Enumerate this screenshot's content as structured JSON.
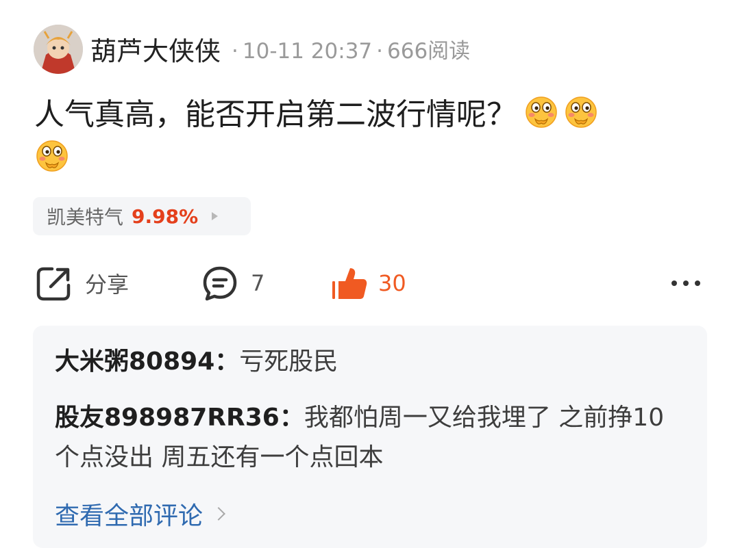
{
  "post": {
    "author": "葫芦大侠侠",
    "separator": "·",
    "timestamp": "10-11 20:37",
    "reads": "666阅读",
    "content": "人气真高，能否开启第二波行情呢？",
    "emoji_icon": "thinking-face-emoji",
    "emoji_count": 3
  },
  "stock": {
    "name": "凯美特气",
    "change": "9.98%",
    "change_color": "#e4401c"
  },
  "actions": {
    "share_label": "分享",
    "comment_count": "7",
    "like_count": "30",
    "like_color": "#f05a22"
  },
  "comments": [
    {
      "user": "大米粥80894",
      "colon": "：",
      "text": "亏死股民"
    },
    {
      "user": "股友898987RR36",
      "colon": "：",
      "text": "我都怕周一又给我埋了 之前挣10个点没出 周五还有一个点回本"
    }
  ],
  "view_all_label": "查看全部评论",
  "colors": {
    "link": "#2f6ab0",
    "comment_bg": "#f6f7f9"
  }
}
